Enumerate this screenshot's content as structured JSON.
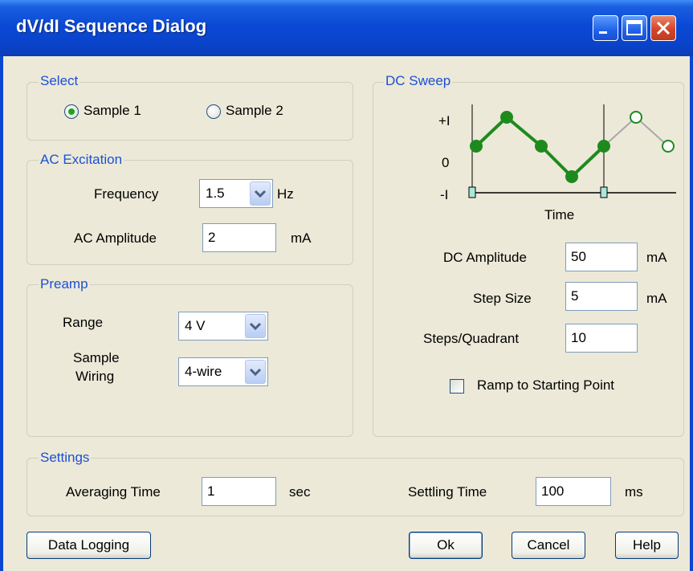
{
  "window": {
    "title": "dV/dI Sequence Dialog"
  },
  "select": {
    "label": "Select",
    "sample1": "Sample 1",
    "sample2": "Sample 2",
    "selected": "Sample 1"
  },
  "ac": {
    "label": "AC Excitation",
    "frequency_label": "Frequency",
    "frequency_value": "1.5",
    "frequency_unit": "Hz",
    "amplitude_label": "AC Amplitude",
    "amplitude_value": "2",
    "amplitude_unit": "mA"
  },
  "preamp": {
    "label": "Preamp",
    "range_label": "Range",
    "range_value": "4 V",
    "wiring_label_1": "Sample",
    "wiring_label_2": "Wiring",
    "wiring_value": "4-wire"
  },
  "dc": {
    "label": "DC Sweep",
    "diagram": {
      "y_plus": "+I",
      "y_zero": "0",
      "y_minus": "-I",
      "x_label": "Time"
    },
    "amplitude_label": "DC Amplitude",
    "amplitude_value": "50",
    "amplitude_unit": "mA",
    "step_label": "Step Size",
    "step_value": "5",
    "step_unit": "mA",
    "steps_label": "Steps/Quadrant",
    "steps_value": "10",
    "ramp_label": "Ramp to Starting Point",
    "ramp_checked": false
  },
  "settings": {
    "label": "Settings",
    "averaging_label": "Averaging Time",
    "averaging_value": "1",
    "averaging_unit": "sec",
    "settling_label": "Settling Time",
    "settling_value": "100",
    "settling_unit": "ms"
  },
  "buttons": {
    "data_logging": "Data Logging",
    "ok": "Ok",
    "cancel": "Cancel",
    "help": "Help"
  },
  "colors": {
    "title_bar": "#0a49d6",
    "group_label": "#1c50d4",
    "sweep_line": "#1e8a1e",
    "sweep_line_inactive": "#a8a8a8"
  }
}
